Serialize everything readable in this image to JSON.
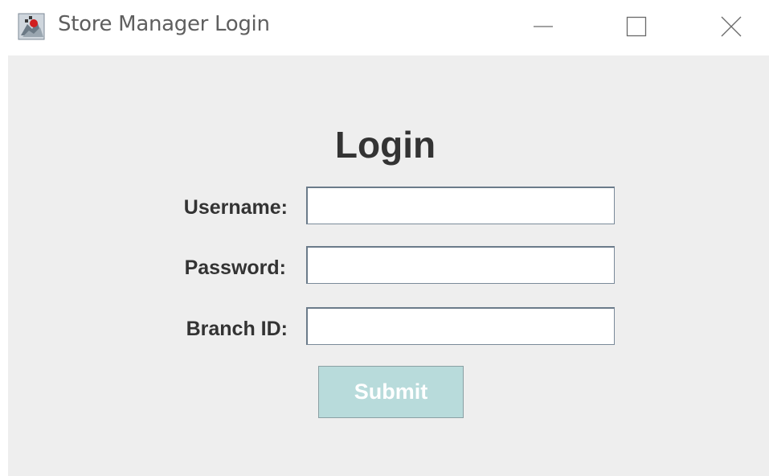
{
  "window": {
    "title": "Store Manager Login"
  },
  "form": {
    "heading": "Login",
    "fields": [
      {
        "label": "Username:",
        "value": "",
        "placeholder": ""
      },
      {
        "label": "Password:",
        "value": "",
        "placeholder": ""
      },
      {
        "label": "Branch ID:",
        "value": "",
        "placeholder": ""
      }
    ],
    "submit_label": "Submit"
  },
  "colors": {
    "content_background": "#eeeeee",
    "submit_background": "#b8dbdb",
    "submit_text": "#ffffff",
    "label_text": "#333333"
  },
  "icons": {
    "app": "java-app-icon",
    "minimize": "minimize-icon",
    "maximize": "maximize-icon",
    "close": "close-icon"
  }
}
